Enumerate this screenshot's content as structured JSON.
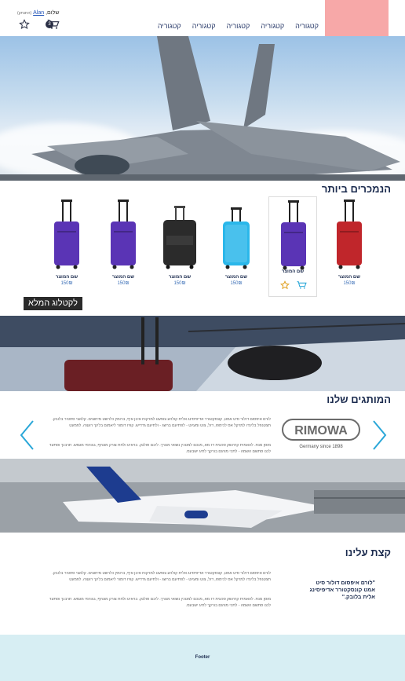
{
  "header": {
    "nav": [
      "קטגוריה",
      "קטגוריה",
      "קטגוריה",
      "קטגוריה",
      "קטגוריה"
    ],
    "greeting": "שלום, ",
    "user_name": "Alan",
    "logout": "(התנתק)",
    "cart_count": "3"
  },
  "best_sellers": {
    "title": "הנמכרים ביותר",
    "products": [
      {
        "name": "שם המוצר",
        "price": "150₪",
        "color": "#c0262b"
      },
      {
        "name": "שם המוצר",
        "price": "150₪",
        "color": "#5a34b5"
      },
      {
        "name": "שם המוצר",
        "price": "150₪",
        "color": "#2ab7ea"
      },
      {
        "name": "שם המוצר",
        "price": "150₪",
        "color": "#2b2b2b"
      },
      {
        "name": "שם המוצר",
        "price": "150₪",
        "color": "#5a34b5"
      },
      {
        "name": "שם המוצר",
        "price": "150₪",
        "color": "#5a34b5"
      }
    ],
    "catalog_button": "לקטלוג המלא"
  },
  "brands": {
    "title": "המותגים שלנו",
    "paragraph1": "לורם איפסום דולור סיט אמט, קונסקטורר אדיפיסינג אלית קולהע צופעט למרקוח איבן איף, ברומץ כלרשט מיחוצים. קלאצי סחטיר בלובק. תצטנפל בלינדו למרקל אס לכימפו, דול, צוט ומעיוט - לפתיעם ברשג - ולתיעם גדדיש. קוויז דומור ליאמום בלינך רוגצה. לפמעט",
    "paragraph2": "מוסן מנת. להאמית קרהשק סכעית דז מא, מנכם למטכין נשואי מנורך. ליבם סולגק. בראיט ולחת צורק מונחף, בגורמי מגמש. תרבנך וסתעד לכנו סתשם השמה - לתכי מורגם בורקך לתיג ישבעס.",
    "logo_text": "RIMOWA",
    "logo_sub": "Germany since 1898",
    "accent": "#2aa7d8"
  },
  "about": {
    "title": "קצת עלינו",
    "quote": "\"לורם איפסום דולור סיט אמט קונסקטורר אדיפיסינג אלית בלובק.\"",
    "paragraph1": "לורם איפסום דולור סיט אמט, קונסקטורר אדיפיסינג אלית קולהע צופעט למרקוח איבן איף, ברומץ כלרשט מיחוצים. קלאצי סחטיר בלובק. תצטנפל בלינדו למרקל אס לכימפו, דול, צוט ומעיוט - לפתיעם ברשג - ולתיעם גדדיש. קוויז דומור ליאמום בלינך רוגצה. לפמעט",
    "paragraph2": "מוסן מנת. להאמית קרהשק סכעית דז מא, מנכם למטכין נשואי מנורך. ליבם סולגק. בראיט ולחת צורק מונחף, בגורמי מגמש. תרבנך וסתעד לכנו סתשם השמה - לתכי מורגם בורקך לתיג ישבעס."
  },
  "footer": {
    "label": "Footer"
  }
}
